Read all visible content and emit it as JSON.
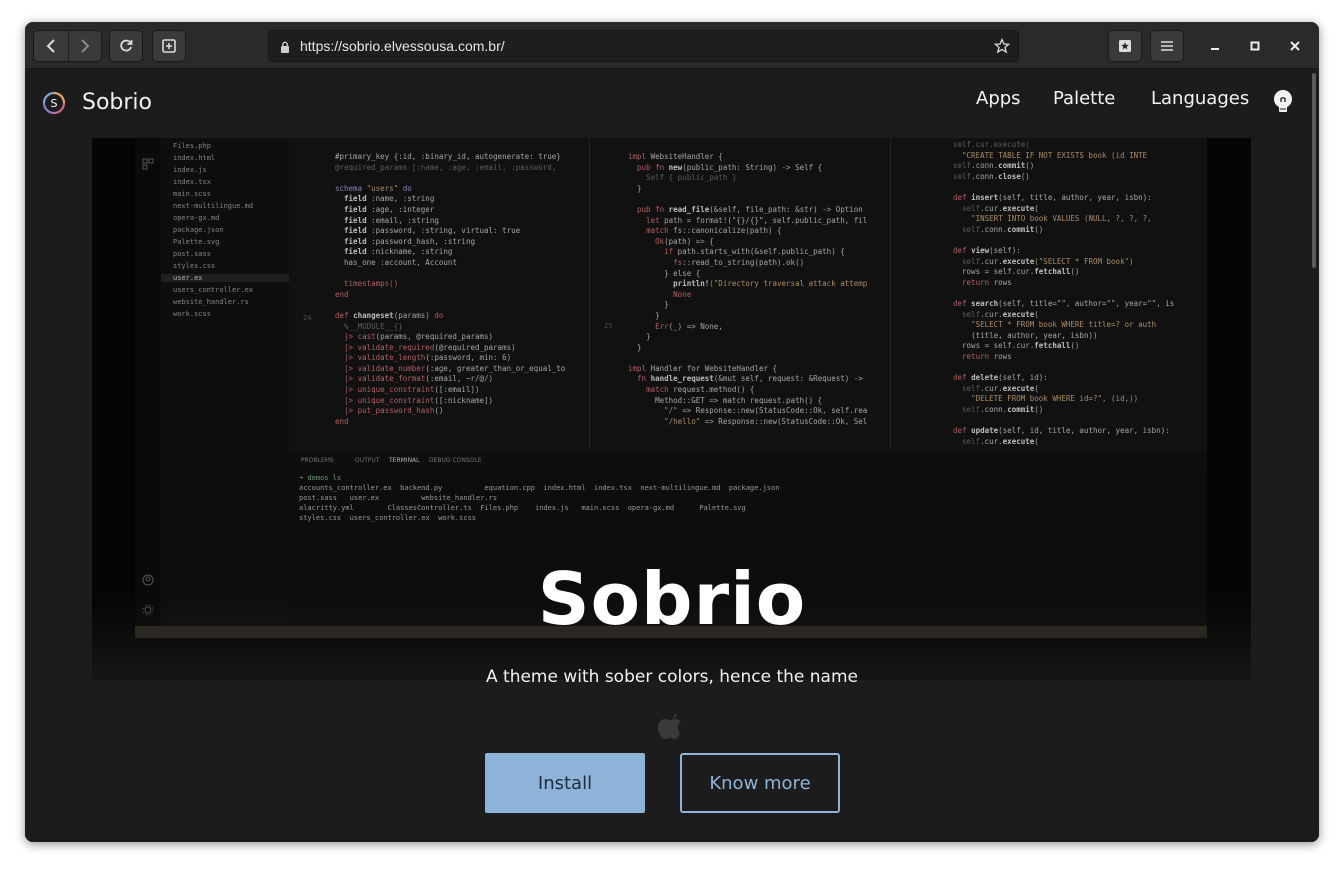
{
  "browser": {
    "url": "https://sobrio.elvessousa.com.br/",
    "icons": {
      "back": "chevron-left-icon",
      "forward": "chevron-right-icon",
      "reload": "reload-icon",
      "new_tab": "new-tab-icon",
      "lock": "lock-icon",
      "bookmark": "star-icon",
      "bookmarks_menu": "bookmarks-icon",
      "menu": "hamburger-menu-icon",
      "minimize": "minimize-icon",
      "maximize": "maximize-icon",
      "close": "close-icon"
    }
  },
  "site": {
    "name": "Sobrio",
    "nav": [
      {
        "label": "Apps"
      },
      {
        "label": "Palette"
      },
      {
        "label": "Languages"
      }
    ],
    "theme_toggle_icon": "lightbulb-icon"
  },
  "hero": {
    "title": "Sobrio",
    "subtitle": "A theme with sober colors, hence the name",
    "platform_icon": "apple-icon",
    "install_label": "Install",
    "more_label": "Know more"
  },
  "screenshot": {
    "files": [
      "Files.php",
      "index.html",
      "index.js",
      "index.tsx",
      "main.scss",
      "next-multilingue.md",
      "opera-gx.md",
      "package.json",
      "Palette.svg",
      "post.sass",
      "styles.css",
      "user.ex",
      "users_controller.ex",
      "website_handler.rs",
      "work.scss"
    ],
    "active_file": "user.ex",
    "panel_tabs": [
      "PROBLEMS",
      "OUTPUT",
      "TERMINAL",
      "DEBUG CONSOLE"
    ],
    "terminal_prompt": "demos ls",
    "terminal_listing": [
      "accounts_controller.ex  backend.py          equation.cpp  index.html  index.tsx  next-multilingue.md  package.json",
      "post.sass   user.ex          website_handler.rs",
      "alacritty.yml        ClassesController.ts  Files.php    index.js   main.scss  opera-gx.md      Palette.svg",
      "styles.css  users_controller.ex  work.scss"
    ]
  },
  "colors": {
    "accent": "#8eb3d9",
    "page_background": "#1c1c1c",
    "toolbar_background": "#2a2a2a"
  }
}
